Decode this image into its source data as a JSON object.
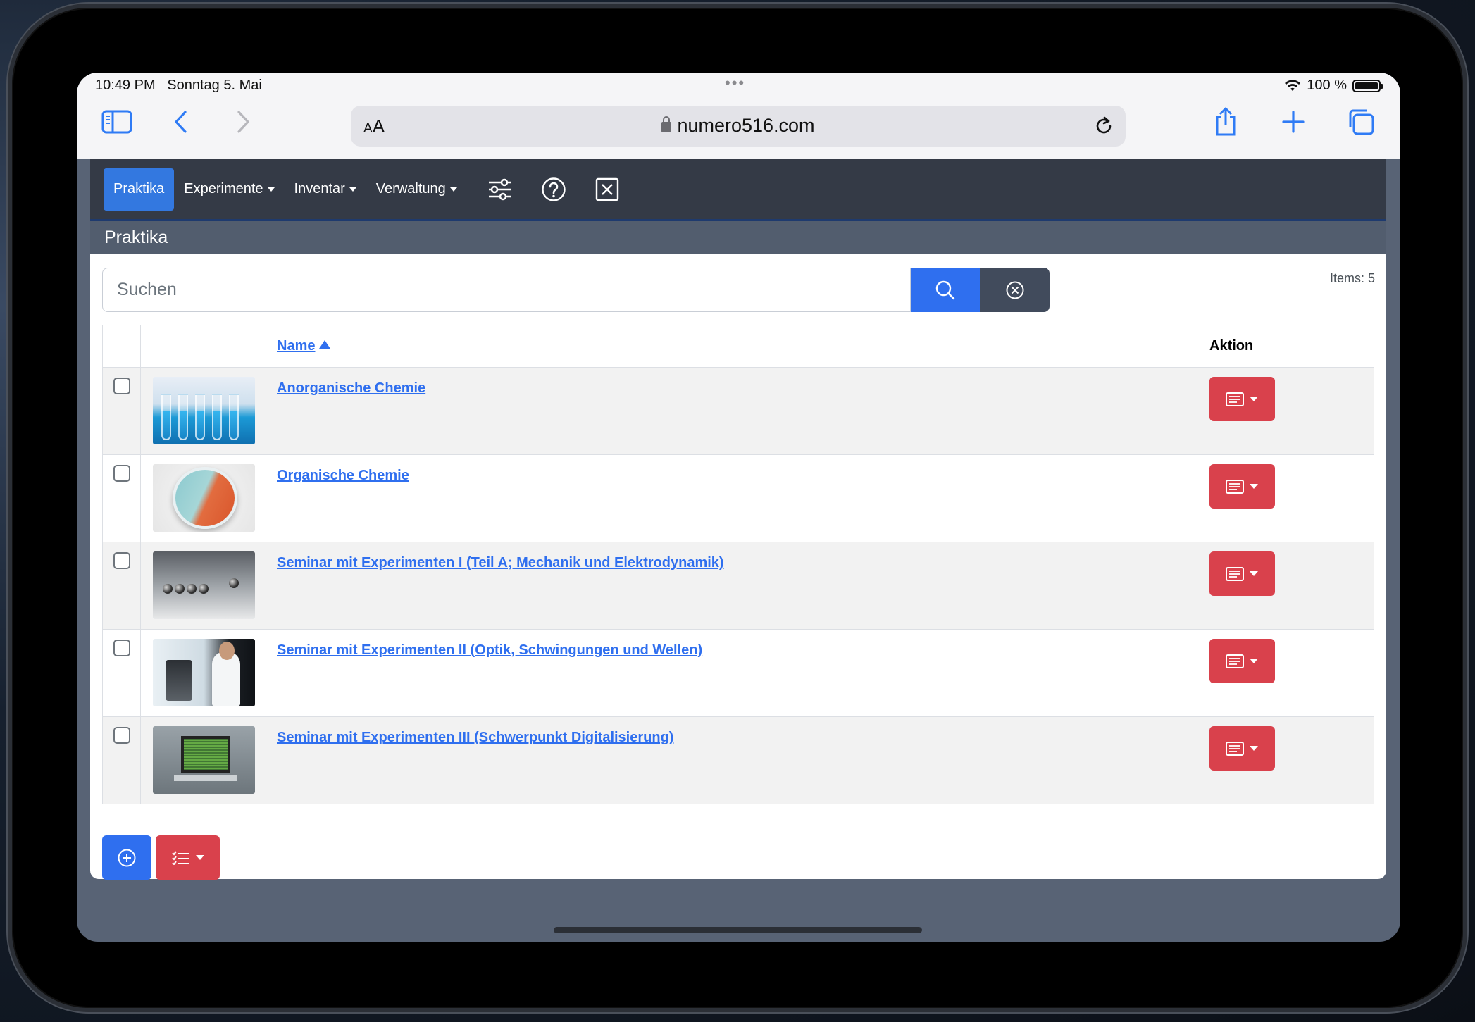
{
  "status": {
    "time": "10:49 PM",
    "date": "Sonntag 5. Mai",
    "battery": "100 %",
    "battery_level": 1.0
  },
  "browser": {
    "aa_label": "AA",
    "url": "numero516.com"
  },
  "nav": {
    "items": [
      {
        "label": "Praktika",
        "active": true,
        "dropdown": false
      },
      {
        "label": "Experimente",
        "active": false,
        "dropdown": true
      },
      {
        "label": "Inventar",
        "active": false,
        "dropdown": true
      },
      {
        "label": "Verwaltung",
        "active": false,
        "dropdown": true
      }
    ],
    "icons": [
      "sliders-icon",
      "help-circle-icon",
      "close-square-icon"
    ]
  },
  "page": {
    "title": "Praktika"
  },
  "search": {
    "placeholder": "Suchen",
    "items_count": "Items: 5"
  },
  "table": {
    "headers": {
      "name": "Name",
      "action": "Aktion"
    },
    "sort": {
      "column": "Name",
      "direction": "ascending"
    },
    "rows": [
      {
        "name": "Anorganische Chemie",
        "thumbnail": "test-tubes"
      },
      {
        "name": "Organische Chemie",
        "thumbnail": "petri-dish"
      },
      {
        "name": "Seminar mit Experimenten I (Teil A; Mechanik und Elektrodynamik)",
        "thumbnail": "newtons-cradle"
      },
      {
        "name": "Seminar mit Experimenten II (Optik, Schwingungen und Wellen)",
        "thumbnail": "microscope-scientist"
      },
      {
        "name": "Seminar mit Experimenten III (Schwerpunkt Digitalisierung)",
        "thumbnail": "lab-laptop"
      }
    ]
  },
  "colors": {
    "primary": "#2f6fef",
    "danger": "#d9414c",
    "navbar": "#343a46",
    "subtitle_bar": "#525d6e"
  }
}
